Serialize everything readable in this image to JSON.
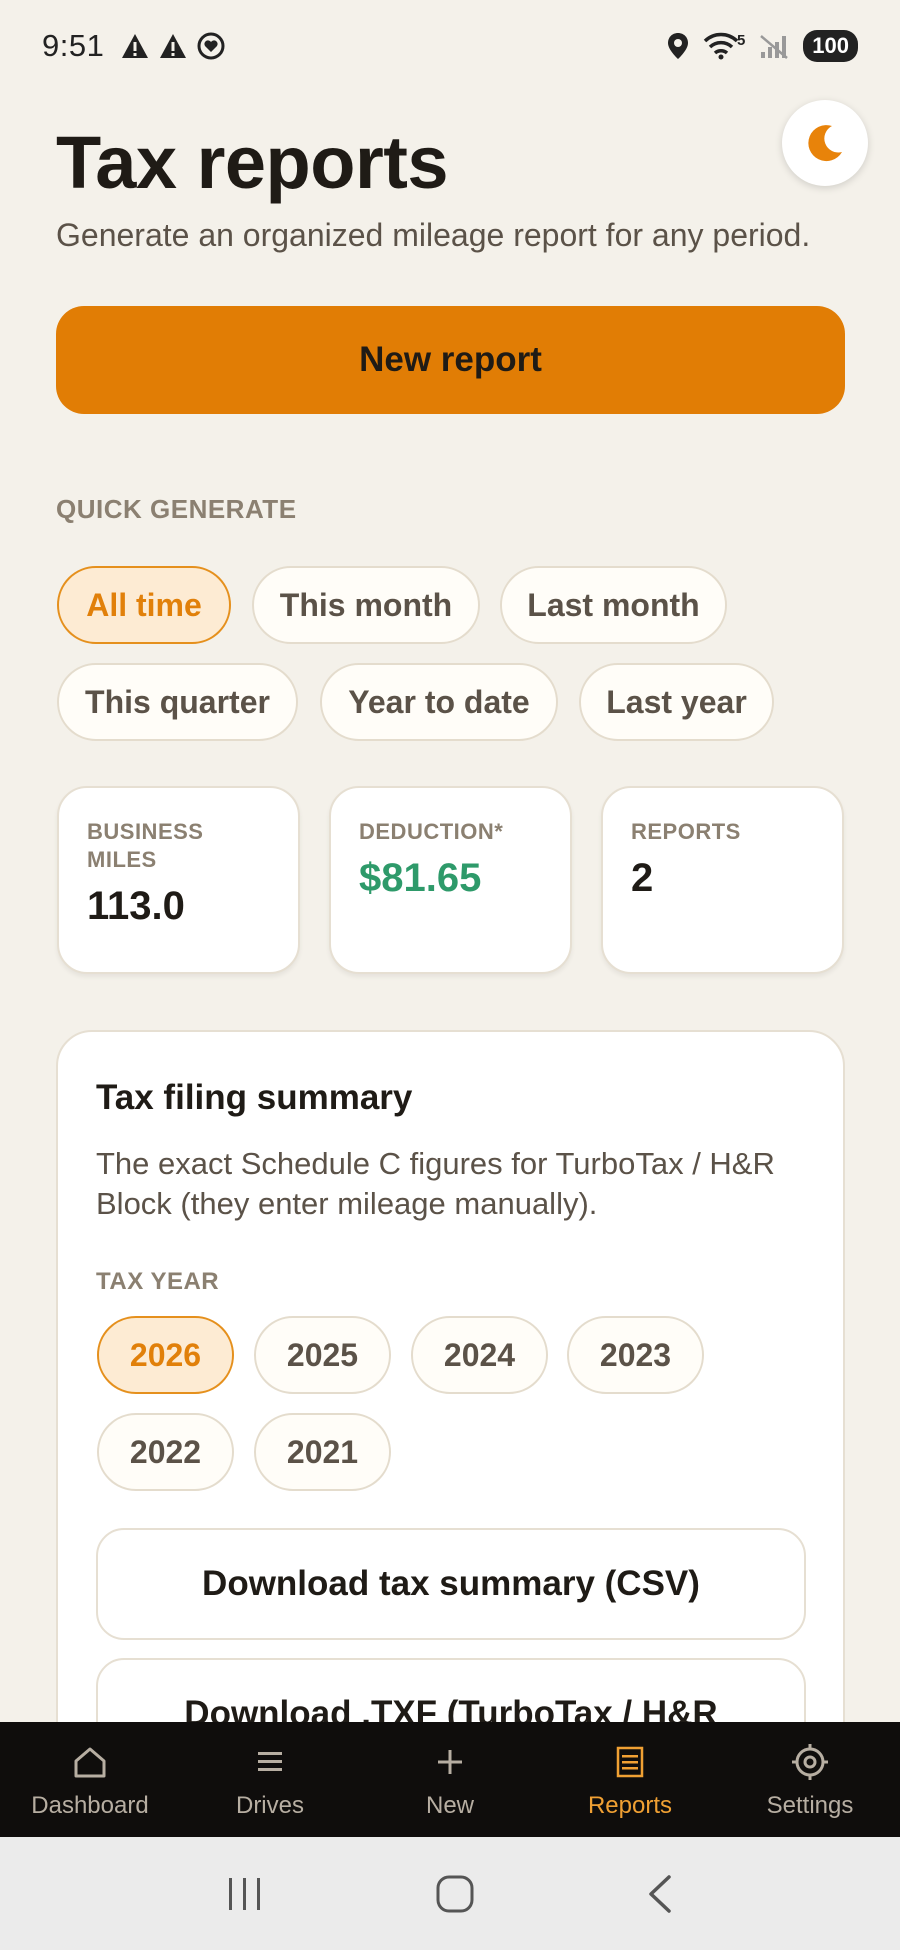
{
  "status_bar": {
    "time": "9:51",
    "icons_left": [
      "warning-icon",
      "warning-icon",
      "shield-heart-icon"
    ],
    "icons_right": [
      "location-icon",
      "wifi-icon",
      "signal-off-icon"
    ],
    "wifi_label": "5",
    "battery": "100"
  },
  "header": {
    "title": "Tax reports",
    "subtitle": "Generate an organized mileage report for any period.",
    "theme_toggle_icon": "moon-icon"
  },
  "primary_action": {
    "label": "New report"
  },
  "quick_generate": {
    "label": "QUICK GENERATE",
    "chips": [
      "All time",
      "This month",
      "Last month",
      "This quarter",
      "Year to date",
      "Last year"
    ],
    "selected": "All time"
  },
  "stats": [
    {
      "label": "BUSINESS MILES",
      "value": "113.0"
    },
    {
      "label": "DEDUCTION*",
      "value": "$81.65"
    },
    {
      "label": "REPORTS",
      "value": "2"
    }
  ],
  "tax_summary": {
    "title": "Tax filing summary",
    "description": "The exact Schedule C figures for TurboTax / H&R Block (they enter mileage manually).",
    "year_label": "TAX YEAR",
    "years": [
      "2026",
      "2025",
      "2024",
      "2023",
      "2022",
      "2021"
    ],
    "selected_year": "2026",
    "download_csv": "Download tax summary (CSV)",
    "download_txf": "Download .TXF (TurboTax / H&R"
  },
  "bottom_nav": {
    "items": [
      {
        "label": "Dashboard",
        "icon": "home-icon"
      },
      {
        "label": "Drives",
        "icon": "list-icon"
      },
      {
        "label": "New",
        "icon": "plus-icon"
      },
      {
        "label": "Reports",
        "icon": "report-icon"
      },
      {
        "label": "Settings",
        "icon": "gear-icon"
      }
    ],
    "active": "Reports"
  },
  "colors": {
    "background": "#f4f1ea",
    "accent": "#e17d05",
    "positive": "#2e9a6a",
    "nav_background": "#0f0d0c"
  }
}
